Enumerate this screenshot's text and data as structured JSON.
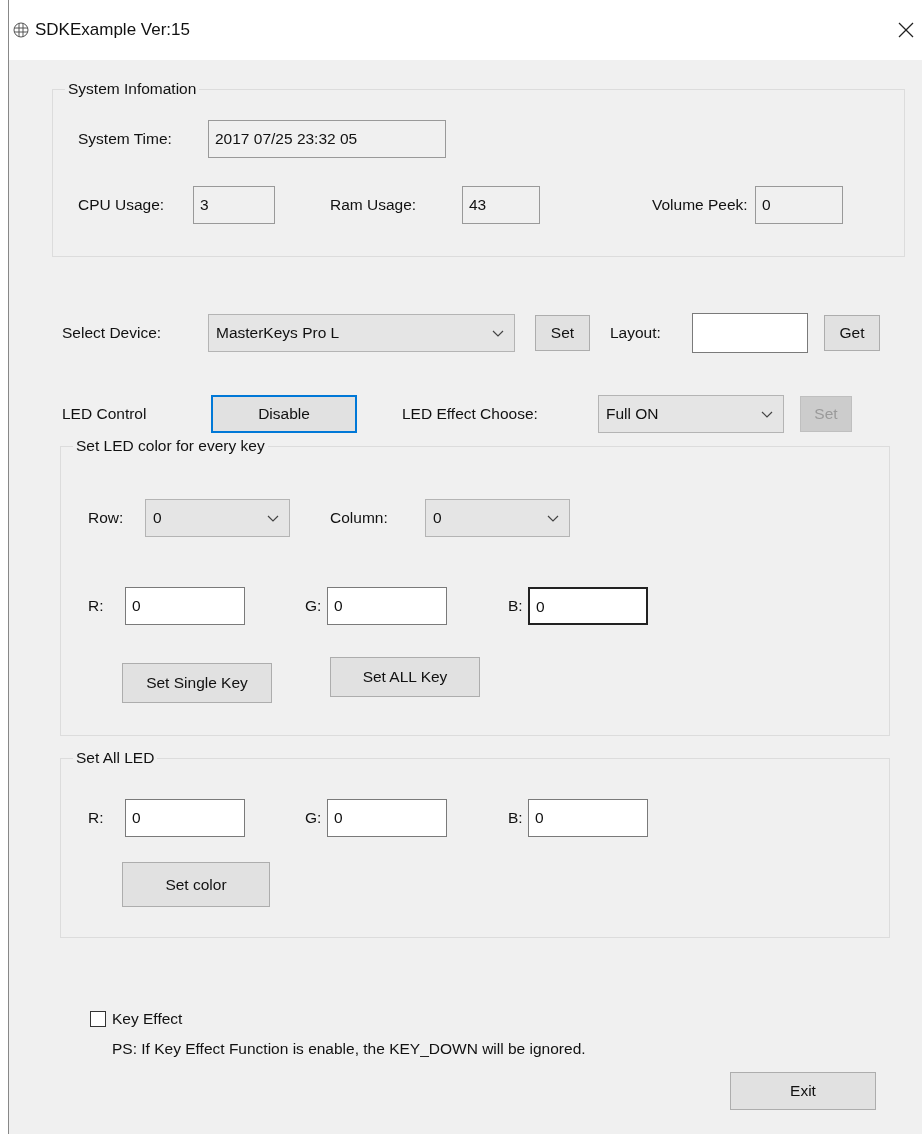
{
  "window": {
    "title": "SDKExample Ver:15"
  },
  "system_info": {
    "title": "System Infomation",
    "time": {
      "label": "System Time:",
      "value": "2017 07/25 23:32 05"
    },
    "stats": [
      {
        "label": "CPU Usage:",
        "value": "3"
      },
      {
        "label": "Ram Usage:",
        "value": "43"
      },
      {
        "label": "Volume Peek:",
        "value": "0"
      }
    ]
  },
  "device": {
    "label": "Select Device:",
    "value": "MasterKeys Pro L",
    "set_button": "Set",
    "layout_label": "Layout:",
    "get_button": "Get"
  },
  "led_control": {
    "label": "LED Control",
    "button": {
      "label": "Disable",
      "focused": true
    },
    "effect_label": "LED Effect Choose:",
    "effect_value": "Full ON",
    "set_button": {
      "label": "Set",
      "disabled": true
    }
  },
  "per_key": {
    "title": "Set LED color for every key",
    "row_label": "Row:",
    "row_value": "0",
    "column_label": "Column:",
    "column_value": "0",
    "channels": [
      {
        "label": "R:",
        "value": "0",
        "focused": false
      },
      {
        "label": "G:",
        "value": "0",
        "focused": false
      },
      {
        "label": "B:",
        "value": "0",
        "focused": true
      }
    ],
    "buttons": [
      "Set Single Key",
      "Set ALL Key"
    ]
  },
  "all_led": {
    "title": "Set All LED",
    "channels": [
      {
        "label": "R:",
        "value": "0",
        "focused": false
      },
      {
        "label": "G:",
        "value": "0",
        "focused": false
      },
      {
        "label": "B:",
        "value": "0",
        "focused": false
      }
    ],
    "button": "Set color"
  },
  "key_effect": {
    "label": "Key Effect",
    "checked": false,
    "note": "PS: If Key Effect Function is enable, the KEY_DOWN will be ignored."
  },
  "exit_button": "Exit"
}
